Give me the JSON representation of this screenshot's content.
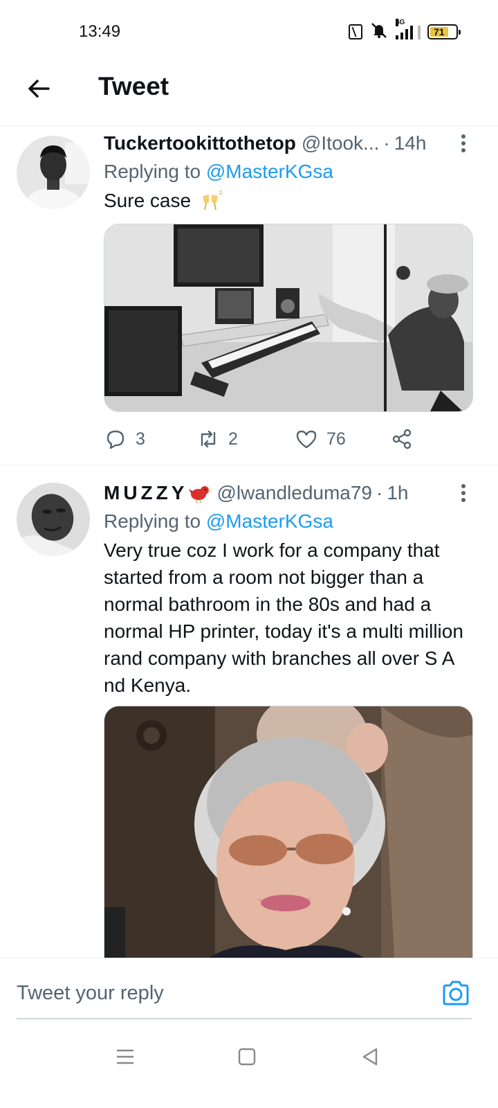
{
  "status_bar": {
    "time": "13:49",
    "network": "4G",
    "battery": "71",
    "battery_level": 0.71,
    "icons": [
      "nfc-icon",
      "mute-icon",
      "signal-icon",
      "battery-icon"
    ]
  },
  "header": {
    "title": "Tweet",
    "back_icon": "arrow-left-icon"
  },
  "tweets": [
    {
      "display_name": "Tuckertookittothetop",
      "handle": "@Itook...",
      "dot": "·",
      "time": "14h",
      "replying_prefix": "Replying to ",
      "replying_to": "@MasterKGsa",
      "text": "Sure case",
      "emoji": "clinking-glasses-icon",
      "media": "studio-photo",
      "replies": "3",
      "retweets": "2",
      "likes": "76"
    },
    {
      "display_name": "MUZZY",
      "handle": "@lwandleduma79",
      "dot": "·",
      "time": "1h",
      "replying_prefix": "Replying to ",
      "replying_to": "@MasterKGsa",
      "text": "Very true coz I work for a company that started from a room not bigger than a normal bathroom in the 80s and had a normal HP printer, today it's a multi million rand company with branches all over S A nd Kenya.",
      "emoji": "red-bird-icon",
      "media": "woman-portrait-photo"
    }
  ],
  "reply_bar": {
    "placeholder": "Tweet your reply",
    "camera_icon": "camera-icon"
  },
  "nav_bar": {
    "buttons": [
      "menu-icon",
      "home-square-icon",
      "back-triangle-icon"
    ]
  },
  "colors": {
    "accent": "#1d9bf0",
    "secondary_text": "#536471",
    "primary_text": "#0f1419",
    "divider": "#eff3f4"
  }
}
